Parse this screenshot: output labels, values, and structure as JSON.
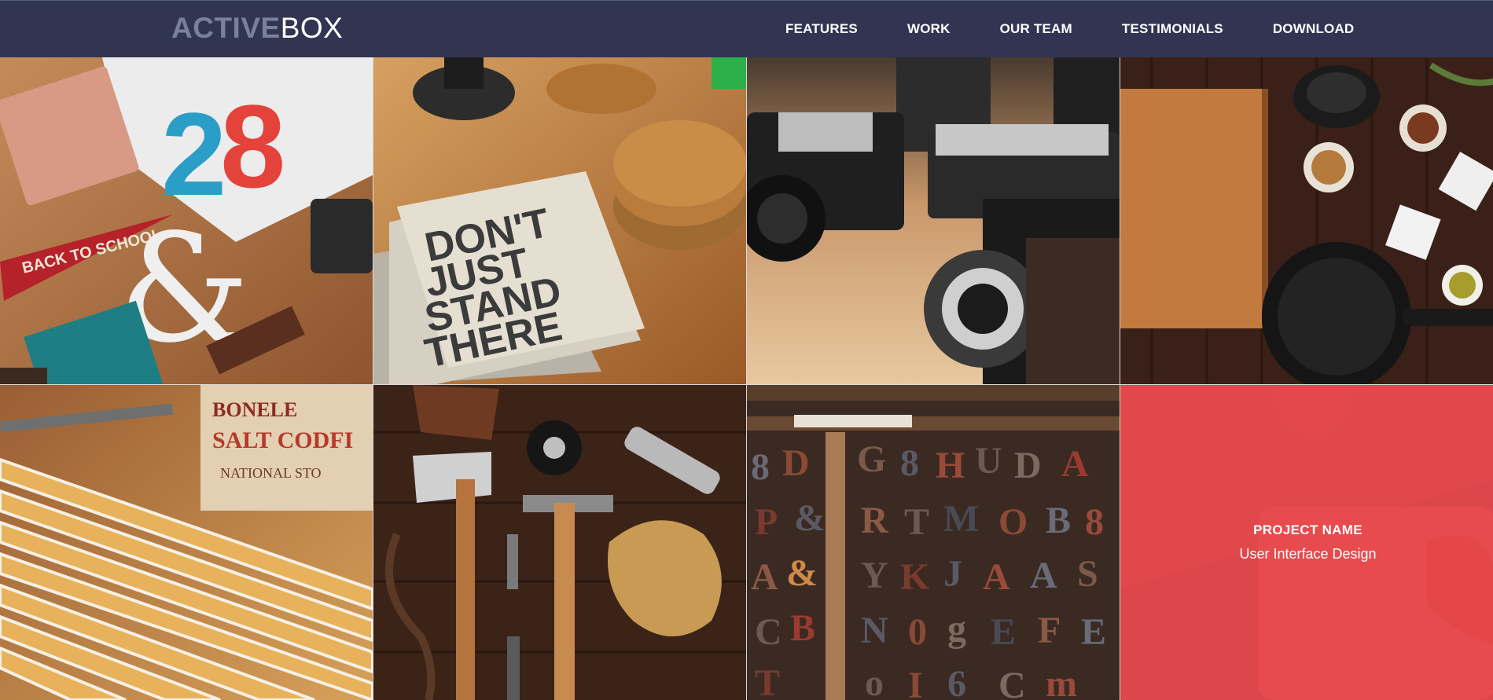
{
  "brand": {
    "logo_bold": "ACTIVE",
    "logo_light": "BOX"
  },
  "nav": {
    "items": [
      {
        "label": "FEATURES"
      },
      {
        "label": "WORK"
      },
      {
        "label": "OUR TEAM"
      },
      {
        "label": "TESTIMONIALS"
      },
      {
        "label": "DOWNLOAD"
      }
    ]
  },
  "colors": {
    "navbar_bg": "#313552",
    "logo_bold": "#7a7f9a",
    "overlay_accent": "#e8484e"
  },
  "portfolio": {
    "tiles": [
      {
        "image": "flatlay-desk-items"
      },
      {
        "image": "notebook-dont-just-stand-there"
      },
      {
        "image": "vintage-cameras"
      },
      {
        "image": "kitchen-table-spices"
      },
      {
        "image": "folding-rulers"
      },
      {
        "image": "tools-hammer-axe-gloves"
      },
      {
        "image": "wood-type-letters"
      },
      {
        "image": "project-hover-tile"
      }
    ],
    "hover": {
      "project_name": "PROJECT NAME",
      "category": "User Interface Design"
    }
  }
}
